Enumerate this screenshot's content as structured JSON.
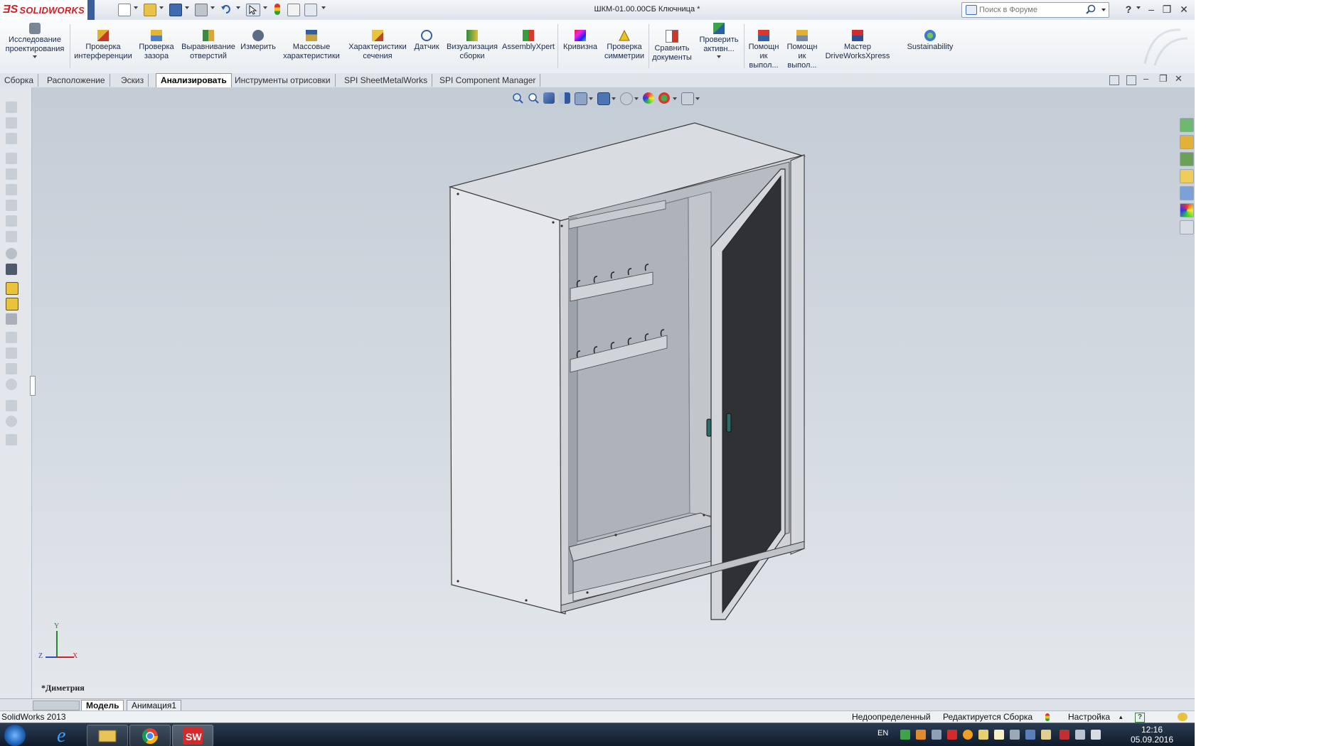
{
  "app": {
    "brand": "SOLIDWORKS",
    "brand_mark": "ƎS",
    "document_title": "ШКМ-01.00.00СБ Ключница *",
    "search_placeholder": "Поиск в Форуме",
    "help": "?"
  },
  "ribbon": {
    "buttons": [
      {
        "label1": "Исследование",
        "label2": "проектирования"
      },
      {
        "label1": "Проверка",
        "label2": "интерференции"
      },
      {
        "label1": "Проверка",
        "label2": "зазора"
      },
      {
        "label1": "Выравнивание",
        "label2": "отверстий"
      },
      {
        "label1": "Измерить",
        "label2": ""
      },
      {
        "label1": "Массовые",
        "label2": "характеристики"
      },
      {
        "label1": "Характеристики",
        "label2": "сечения"
      },
      {
        "label1": "Датчик",
        "label2": ""
      },
      {
        "label1": "Визуализация",
        "label2": "сборки"
      },
      {
        "label1": "AssemblyXpert",
        "label2": ""
      },
      {
        "label1": "Кривизна",
        "label2": ""
      },
      {
        "label1": "Проверка",
        "label2": "симметрии"
      },
      {
        "label1": "Сравнить",
        "label2": "документы"
      },
      {
        "label1": "Проверить",
        "label2": "активн..."
      },
      {
        "label1": "Помощн",
        "label2": "ик",
        "label3": "выпол..."
      },
      {
        "label1": "Помощн",
        "label2": "ик",
        "label3": "выпол..."
      },
      {
        "label1": "Мастер",
        "label2": "DriveWorksXpress"
      },
      {
        "label1": "Sustainability",
        "label2": ""
      }
    ]
  },
  "tabs": [
    "Сборка",
    "Расположение",
    "Эскиз",
    "Анализировать",
    "Инструменты отрисовки",
    "SPI SheetMetalWorks",
    "SPI Component Manager"
  ],
  "active_tab": "Анализировать",
  "viewport": {
    "view_label": "*Диметрия",
    "triad": {
      "x": "X",
      "y": "Y",
      "z": "Z"
    }
  },
  "bottom_tabs": [
    "Модель",
    "Анимация1"
  ],
  "status": {
    "app_version": "SolidWorks 2013",
    "definition": "Недоопределенный",
    "editing": "Редактируется Сборка",
    "settings": "Настройка",
    "help": "?"
  },
  "taskbar": {
    "language": "EN",
    "time": "12:16",
    "date": "05.09.2016"
  },
  "colors": {
    "brand_red": "#d31f26",
    "viewport_top": "#c4ccd6",
    "cabinet_face": "#e6e8eb",
    "door_panel": "#2f3134"
  }
}
